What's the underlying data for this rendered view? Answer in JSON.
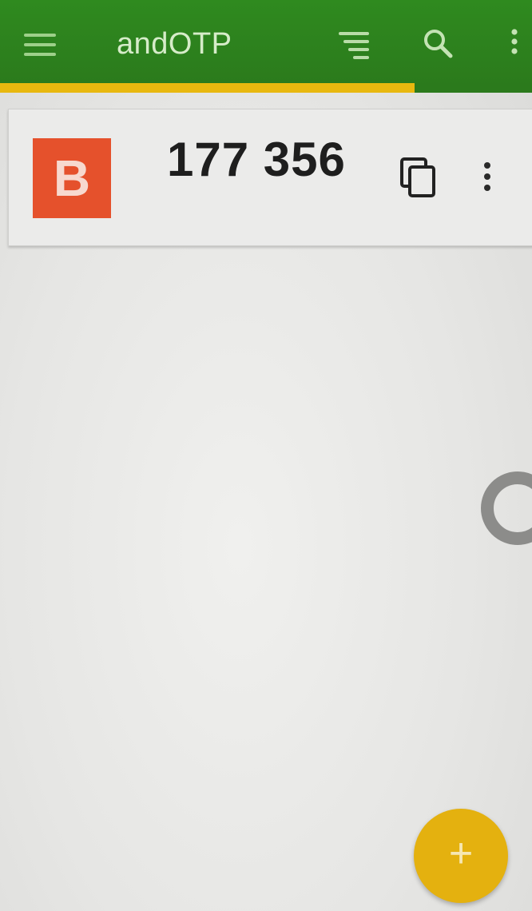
{
  "app": {
    "title": "andOTP"
  },
  "toolbar": {
    "nav_icon": "hamburger-menu-icon",
    "actions": [
      {
        "icon": "sort-icon"
      },
      {
        "icon": "search-icon"
      },
      {
        "icon": "overflow-menu-icon"
      }
    ]
  },
  "entries": [
    {
      "avatar_letter": "B",
      "avatar_color": "#e5512c",
      "code": "177 356",
      "copy_icon": "copy-icon",
      "menu_icon": "more-vert-icon"
    }
  ],
  "token_progress": 0.78,
  "fab": {
    "label": "+",
    "color": "#e4b10f"
  },
  "colors": {
    "primary": "#2e7d1f",
    "accent": "#e8b80f"
  }
}
